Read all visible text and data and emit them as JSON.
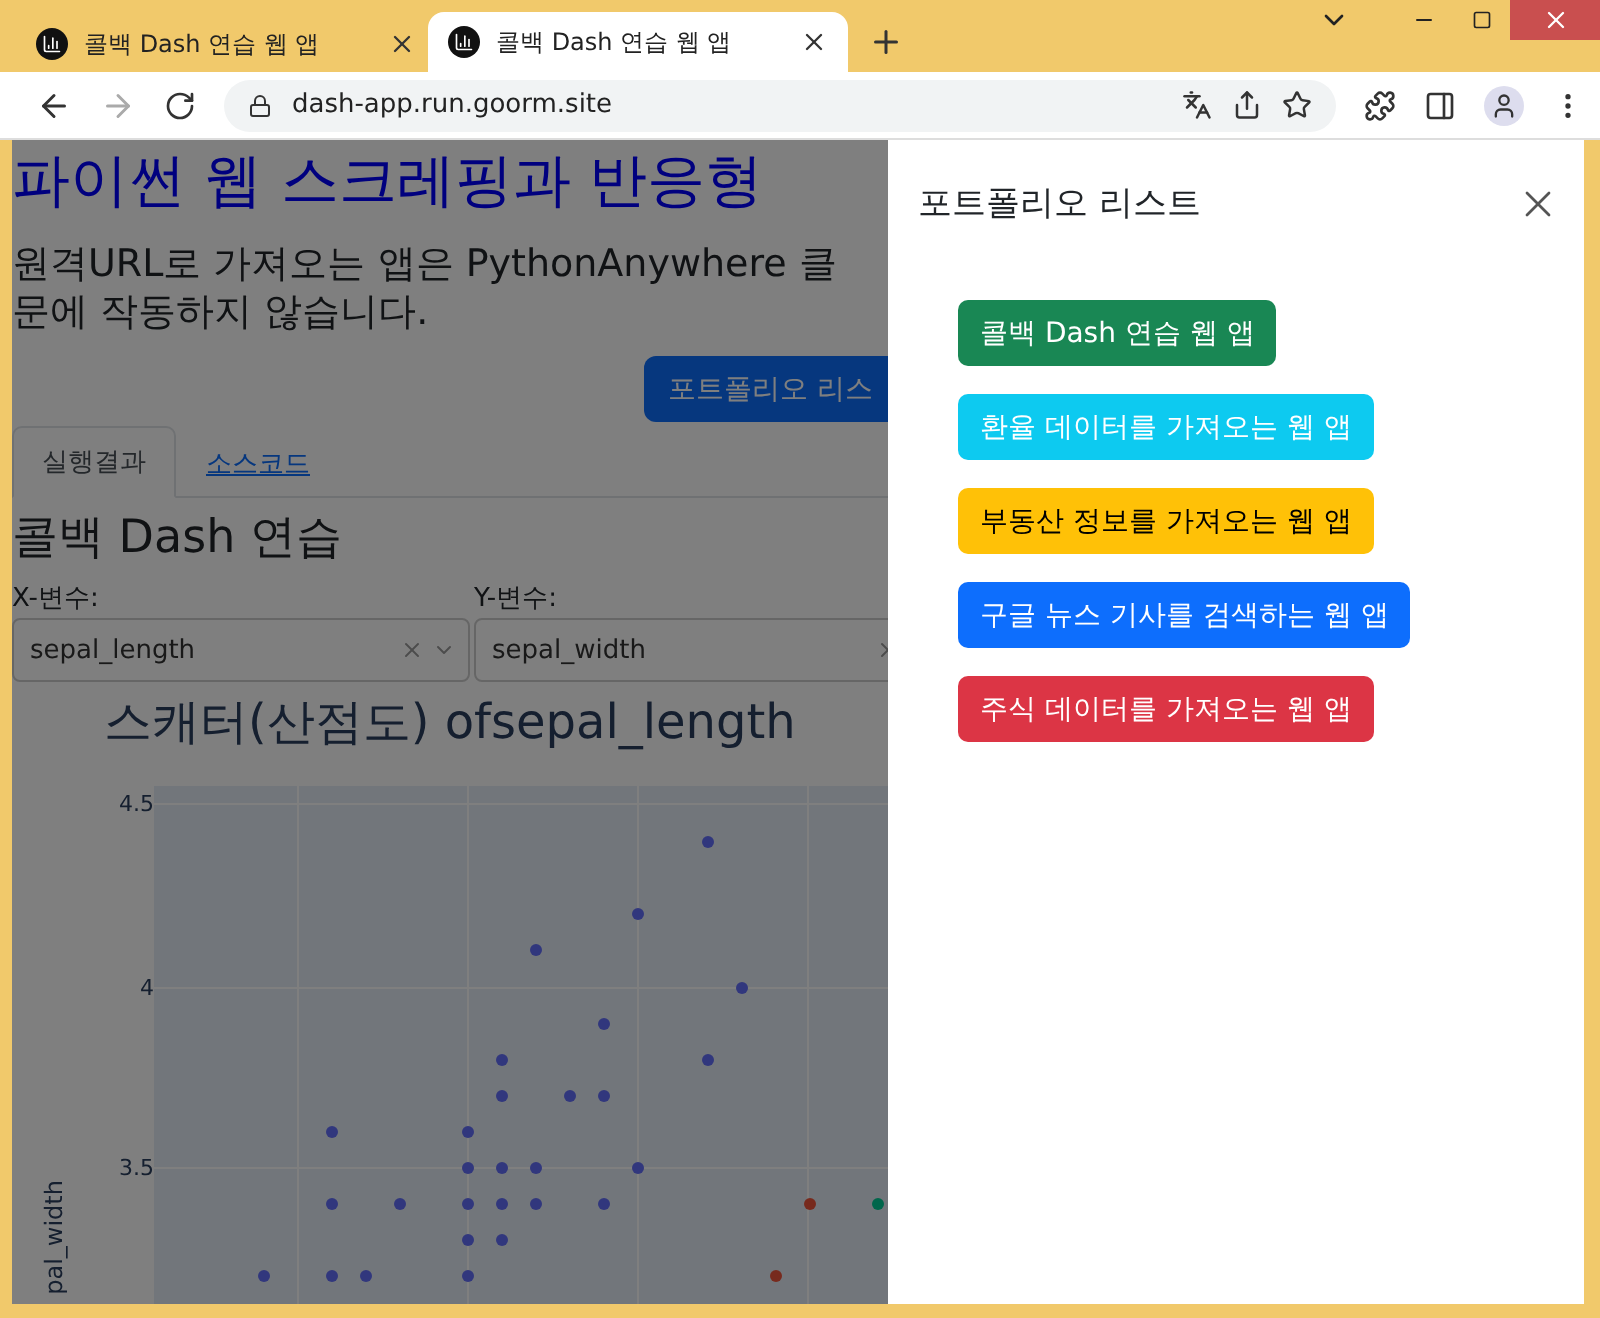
{
  "browser": {
    "tabs": [
      {
        "title": "콜백 Dash 연습 웹 앱",
        "selected": false
      },
      {
        "title": "콜백 Dash 연습 웹 앱",
        "selected": true
      }
    ],
    "address": "dash-app.run.goorm.site"
  },
  "page": {
    "heading": "파이썬 웹 스크레핑과 반응형",
    "notice_lines": [
      "원격URL로 가져오는 앱은 PythonAnywhere 클",
      "문에 작동하지 않습니다."
    ],
    "portfolio_button": "포트폴리오 리스",
    "tabs": [
      {
        "label": "실행결과",
        "selected": true
      },
      {
        "label": "소스코드",
        "selected": false
      }
    ],
    "section_title": "콜백 Dash 연습",
    "controls": [
      {
        "label": "X-변수:",
        "value": "sepal_length"
      },
      {
        "label": "Y-변수:",
        "value": "sepal_width"
      }
    ],
    "chart": {
      "title": "스캐터(산점도) ofsepal_length",
      "ytick_labels": [
        "4.5",
        "4",
        "3.5"
      ],
      "ylabel": "pal_width"
    }
  },
  "offcanvas": {
    "title": "포트폴리오 리스트",
    "buttons": [
      {
        "label": "콜백 Dash 연습 웹 앱",
        "color": "#198754"
      },
      {
        "label": "환율 데이터를 가져오는 웹 앱",
        "color": "#0dcaf0"
      },
      {
        "label": "부동산 정보를 가져오는 웹 앱",
        "color": "#ffc107"
      },
      {
        "label": "구글 뉴스 기사를 검색하는 웹 앱",
        "color": "#0d6efd"
      },
      {
        "label": "주식 데이터를 가져오는 웹 앱",
        "color": "#dc3545"
      }
    ]
  }
}
